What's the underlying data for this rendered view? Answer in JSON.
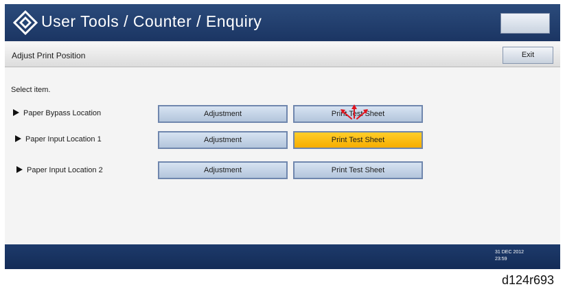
{
  "header": {
    "title": "User Tools / Counter / Enquiry",
    "logo_icon": "diamond-logo-icon"
  },
  "subheader": {
    "title": "Adjust Print Position",
    "exit_label": "Exit"
  },
  "main": {
    "select_label": "Select item.",
    "rows": [
      {
        "label": "Paper Bypass Location",
        "adjust_label": "Adjustment",
        "print_label": "Print Test Sheet",
        "print_selected": false
      },
      {
        "label": "Paper Input Location 1",
        "adjust_label": "Adjustment",
        "print_label": "Print Test Sheet",
        "print_selected": true
      },
      {
        "label": "Paper Input Location 2",
        "adjust_label": "Adjustment",
        "print_label": "Print Test Sheet",
        "print_selected": false
      }
    ]
  },
  "footer": {
    "date": "31 DEC 2012",
    "time": "23:59"
  },
  "figure_id": "d124r693",
  "colors": {
    "header": "#1f3b6b",
    "selected_button": "#ffc000",
    "button": "#c5d4e8",
    "pointer": "#e0141e"
  }
}
